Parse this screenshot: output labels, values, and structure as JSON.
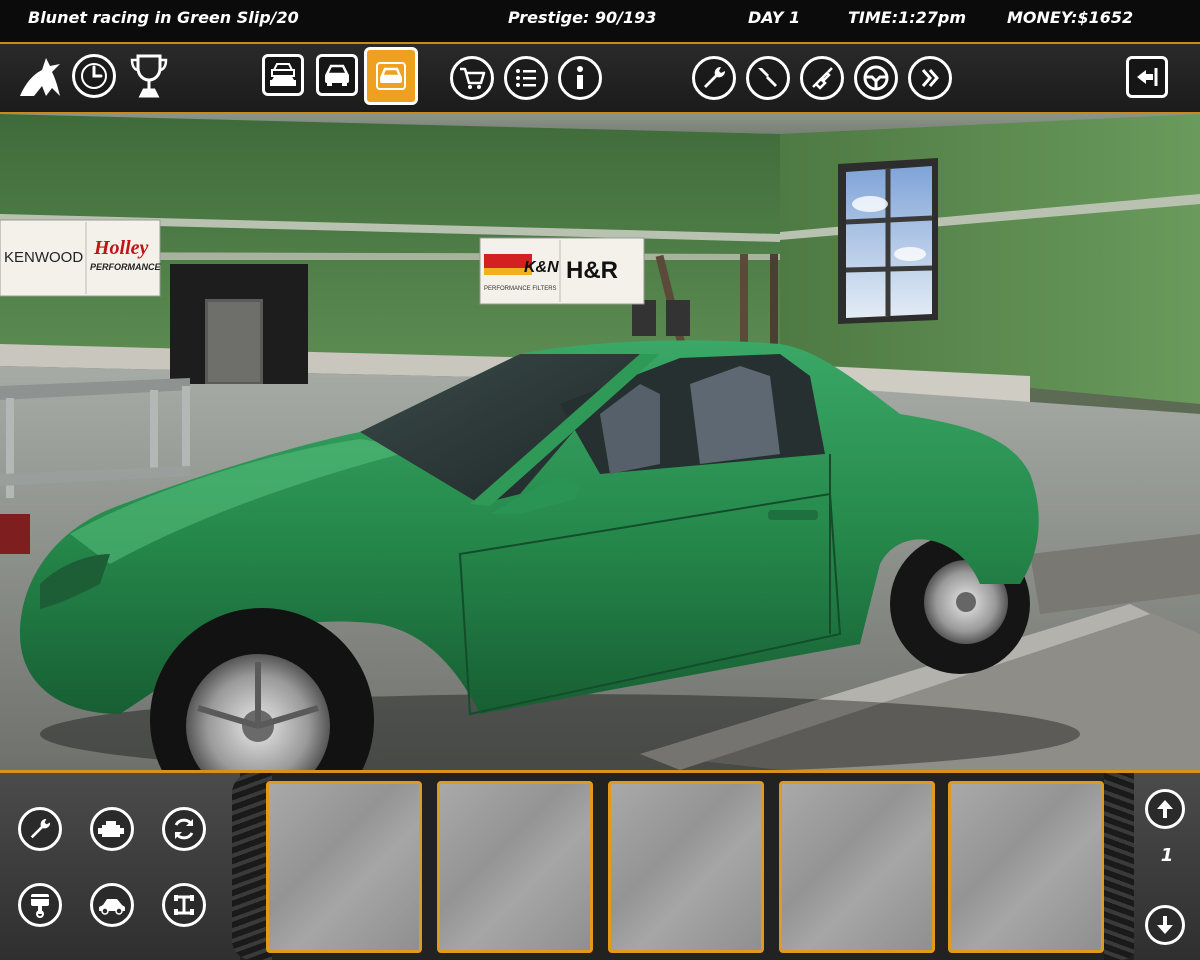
{
  "status": {
    "title": "Blunet racing in Green Slip/20",
    "prestige": "Prestige: 90/193",
    "day": "DAY 1",
    "time": "TIME:1:27pm",
    "money": "MONEY:$1652"
  },
  "toolbar": {
    "left_icons": [
      "bird-logo-icon",
      "clock-icon",
      "trophy-icon"
    ],
    "view_tabs": [
      "garage-cars-icon",
      "car-front-icon",
      "car-selected-icon"
    ],
    "active_view_tab": 2,
    "shop_icons": [
      "shopping-cart-icon",
      "list-icon",
      "info-icon"
    ],
    "tool_icons": [
      "wrench-icon",
      "screwdriver-icon",
      "spark-plug-icon",
      "steering-wheel-icon",
      "fast-forward-icon"
    ],
    "exit_icon": "exit-icon"
  },
  "garage": {
    "signs": {
      "kenwood": "KENWOOD",
      "holley": "Holley",
      "holley_sub": "PERFORMANCE",
      "kn": "K&N",
      "kn_sub": "PERFORMANCE FILTERS",
      "hr": "H&R"
    }
  },
  "bottom": {
    "category_icons": [
      "wrench-icon",
      "engine-icon",
      "refresh-icon",
      "piston-icon",
      "car-body-icon",
      "chassis-icon"
    ],
    "slot_count": 5,
    "page_number": "1",
    "nav": [
      "arrow-up-icon",
      "arrow-down-icon"
    ]
  },
  "colors": {
    "accent": "#f0a020",
    "car": "#2a8a4e",
    "wall_green": "#5b8a4e"
  }
}
